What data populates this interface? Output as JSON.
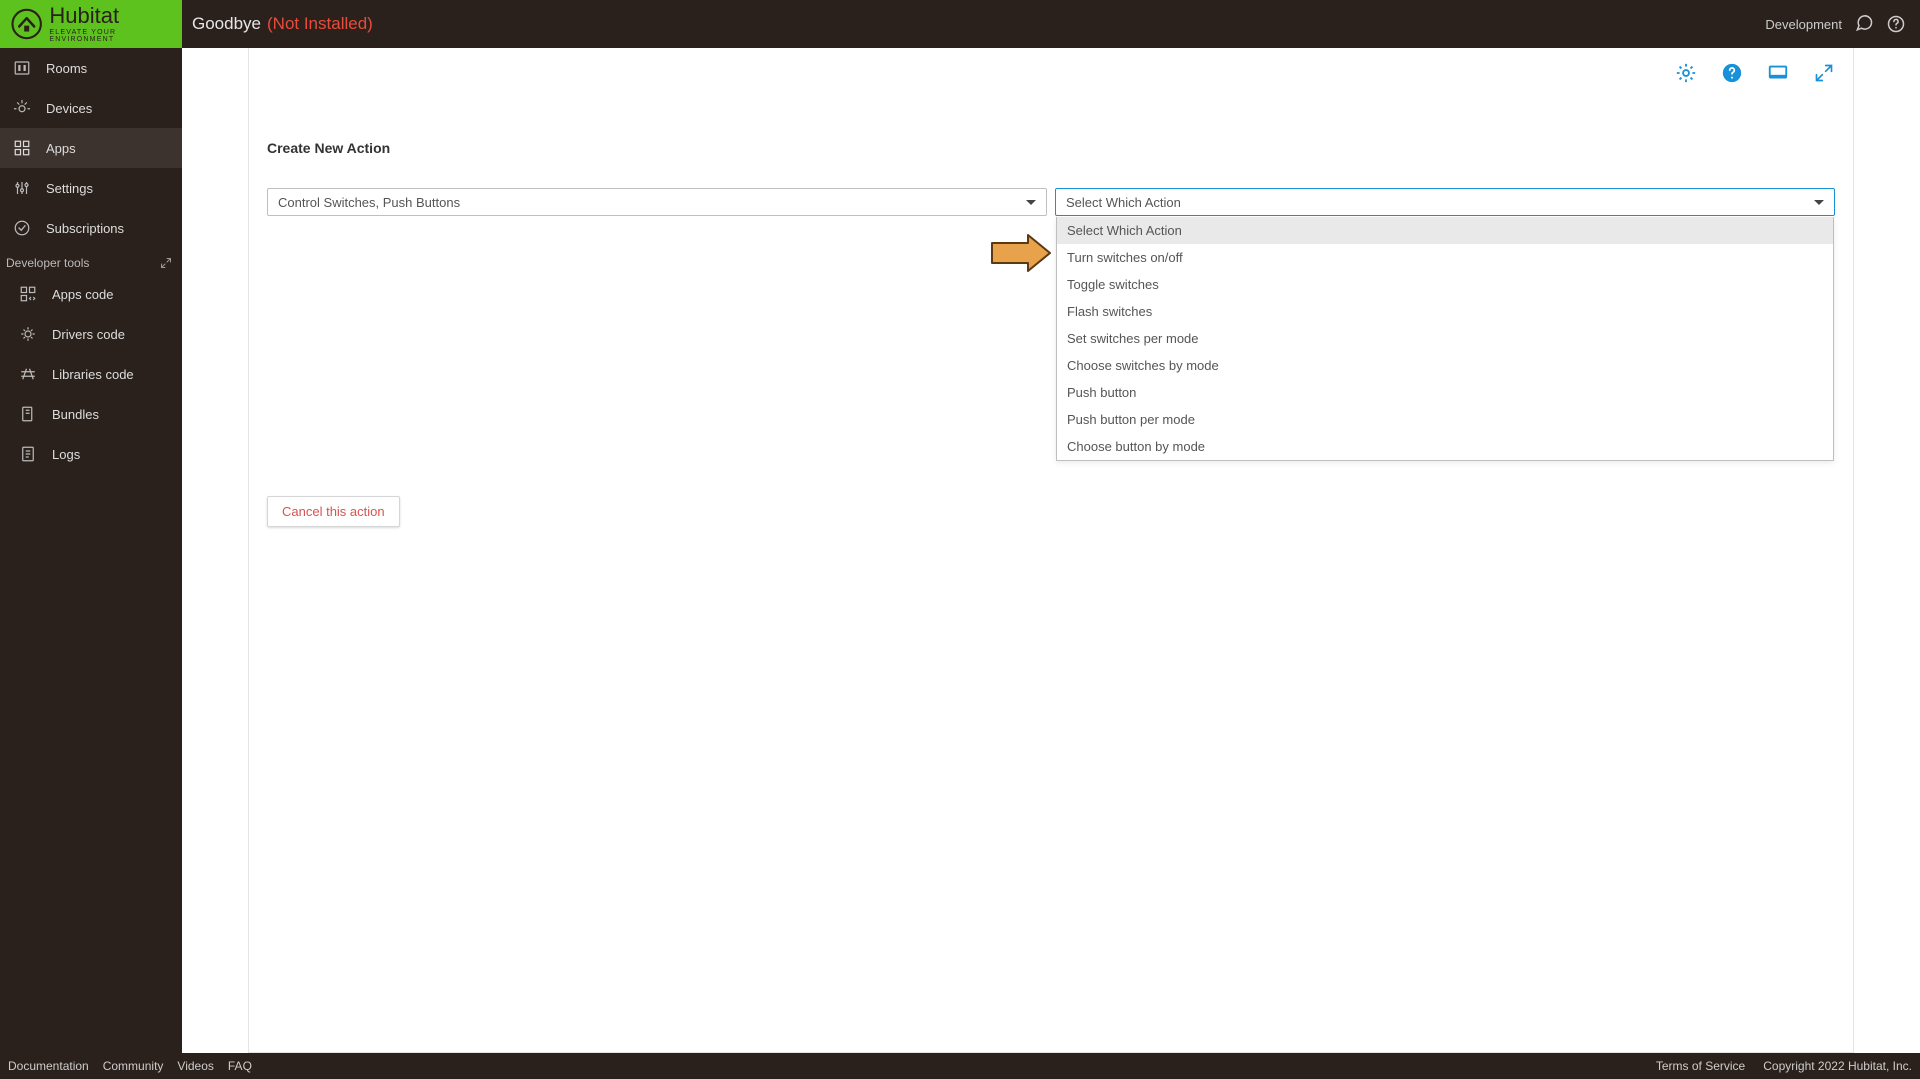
{
  "brand": {
    "name": "Hubitat",
    "tagline": "ELEVATE YOUR ENVIRONMENT"
  },
  "header": {
    "title": "Goodbye",
    "status": "(Not Installed)",
    "env_label": "Development"
  },
  "sidebar": {
    "items": [
      {
        "id": "rooms",
        "label": "Rooms"
      },
      {
        "id": "devices",
        "label": "Devices"
      },
      {
        "id": "apps",
        "label": "Apps",
        "active": true
      },
      {
        "id": "settings",
        "label": "Settings"
      },
      {
        "id": "subscriptions",
        "label": "Subscriptions"
      }
    ],
    "dev_section_label": "Developer tools",
    "dev_items": [
      {
        "id": "apps-code",
        "label": "Apps code"
      },
      {
        "id": "drivers-code",
        "label": "Drivers code"
      },
      {
        "id": "libraries-code",
        "label": "Libraries code"
      },
      {
        "id": "bundles",
        "label": "Bundles"
      },
      {
        "id": "logs",
        "label": "Logs"
      }
    ]
  },
  "main": {
    "section_heading": "Create New Action",
    "select_action_type": {
      "value": "Control Switches, Push Buttons"
    },
    "select_which_action": {
      "placeholder": "Select Which Action",
      "options": [
        "Select Which Action",
        "Turn switches on/off",
        "Toggle switches",
        "Flash switches",
        "Set switches per mode",
        "Choose switches by mode",
        "Push button",
        "Push button per mode",
        "Choose button by mode"
      ]
    },
    "cancel_label": "Cancel this action"
  },
  "footer": {
    "left": [
      "Documentation",
      "Community",
      "Videos",
      "FAQ"
    ],
    "right": [
      "Terms of Service",
      "Copyright 2022 Hubitat, Inc."
    ]
  },
  "colors": {
    "brand_green": "#5dc21e",
    "bar_brown": "#2b211c",
    "accent_blue": "#1791d8",
    "danger": "#d9534f",
    "status_red": "#e74c3c"
  }
}
